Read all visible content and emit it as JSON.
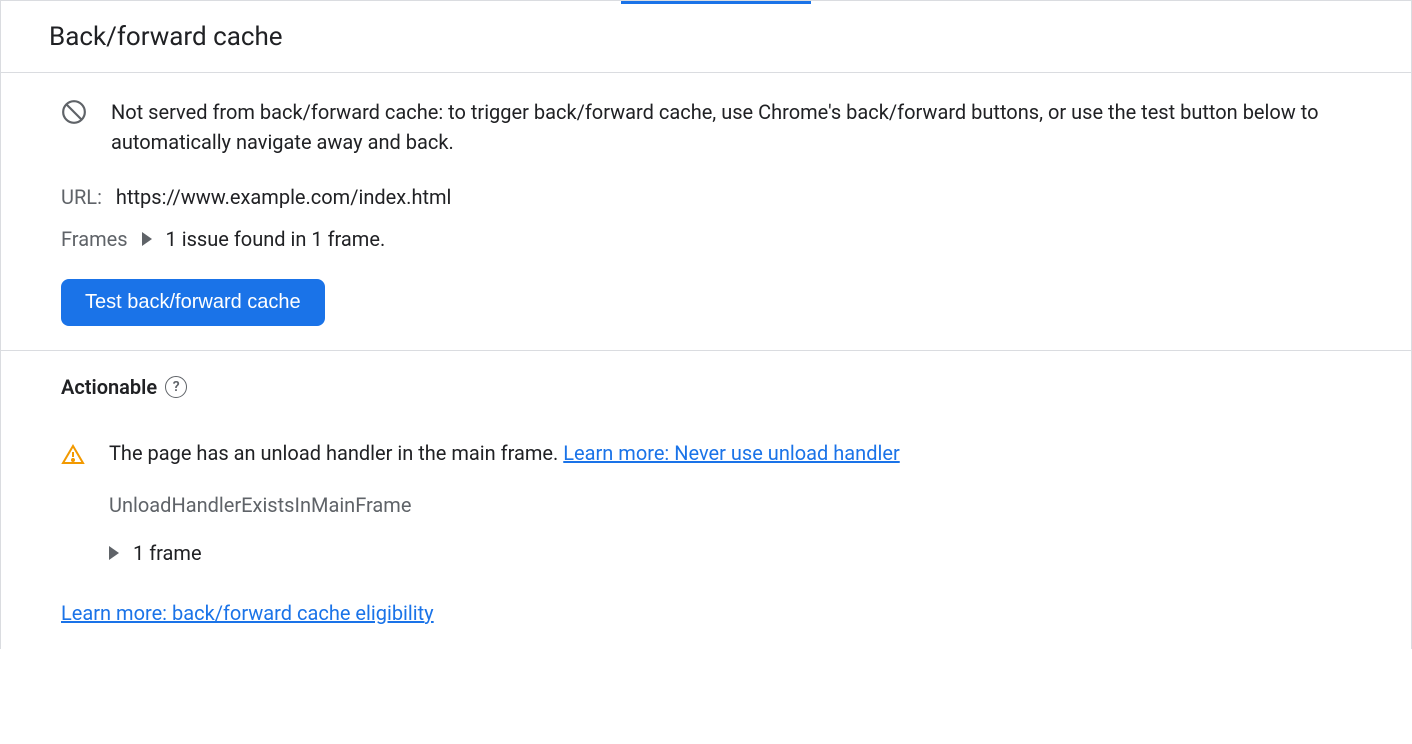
{
  "header": {
    "title": "Back/forward cache"
  },
  "status": {
    "message": "Not served from back/forward cache: to trigger back/forward cache, use Chrome's back/forward buttons, or use the test button below to automatically navigate away and back."
  },
  "url": {
    "label": "URL:",
    "value": "https://www.example.com/index.html"
  },
  "frames": {
    "label": "Frames",
    "summary": "1 issue found in 1 frame."
  },
  "test_button": "Test back/forward cache",
  "actionable": {
    "title": "Actionable",
    "issue": {
      "text": "The page has an unload handler in the main frame. ",
      "link_text": "Learn more: Never use unload handler",
      "reason": "UnloadHandlerExistsInMainFrame",
      "frame_count": "1 frame"
    }
  },
  "footer_link": "Learn more: back/forward cache eligibility"
}
